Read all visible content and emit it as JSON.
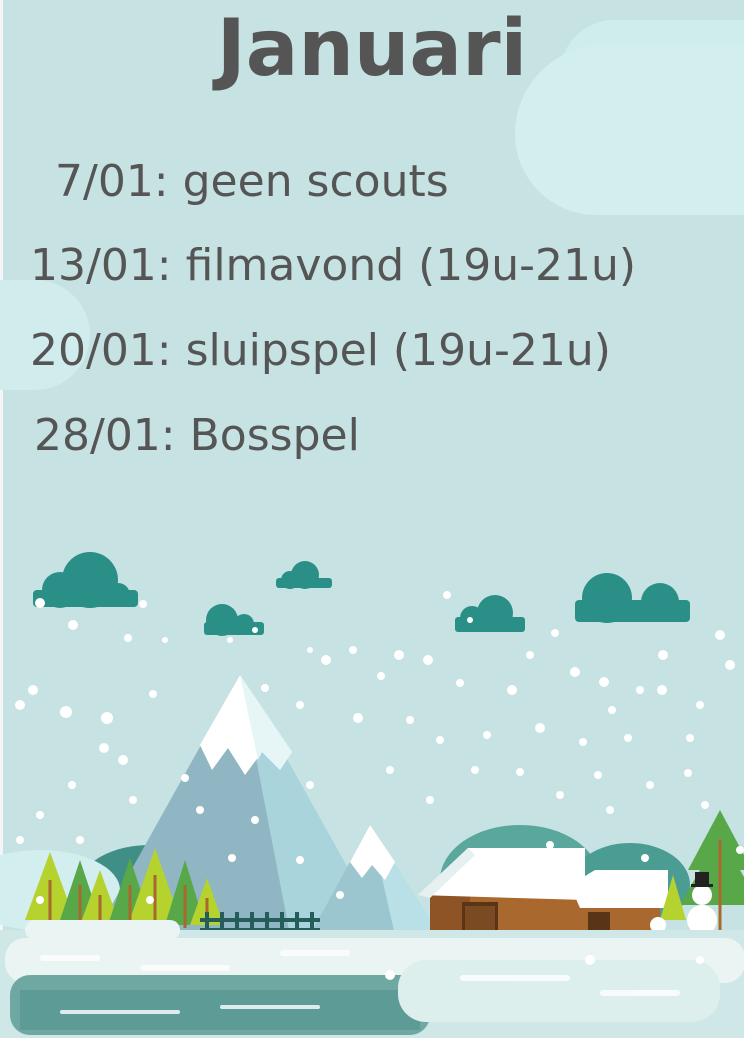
{
  "title": "Januari",
  "events": [
    {
      "text": "7/01: geen scouts"
    },
    {
      "text": "13/01: filmavond (19u-21u)"
    },
    {
      "text": "20/01: sluipspel (19u-21u)"
    },
    {
      "text": "28/01: Bosspel"
    }
  ],
  "colors": {
    "background": "#c6e2e2",
    "text": "#555555",
    "cloud": "#2a8f86",
    "mountain": "#8fb9c4",
    "snow": "#ffffff",
    "house": "#a8682e",
    "tree_light": "#b5d22f",
    "tree_dark": "#58a84a"
  }
}
